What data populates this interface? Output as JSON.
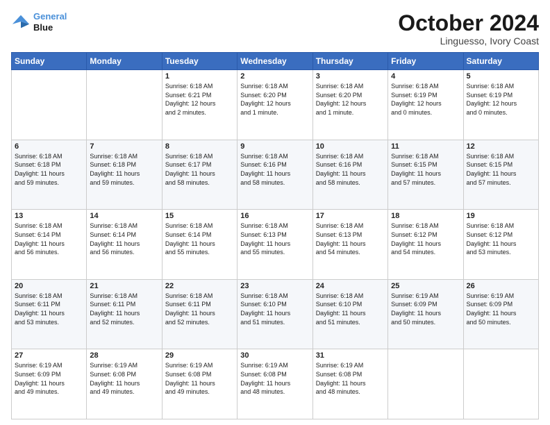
{
  "header": {
    "logo_line1": "General",
    "logo_line2": "Blue",
    "month": "October 2024",
    "location": "Linguesso, Ivory Coast"
  },
  "weekdays": [
    "Sunday",
    "Monday",
    "Tuesday",
    "Wednesday",
    "Thursday",
    "Friday",
    "Saturday"
  ],
  "weeks": [
    [
      {
        "day": "",
        "info": ""
      },
      {
        "day": "",
        "info": ""
      },
      {
        "day": "1",
        "info": "Sunrise: 6:18 AM\nSunset: 6:21 PM\nDaylight: 12 hours\nand 2 minutes."
      },
      {
        "day": "2",
        "info": "Sunrise: 6:18 AM\nSunset: 6:20 PM\nDaylight: 12 hours\nand 1 minute."
      },
      {
        "day": "3",
        "info": "Sunrise: 6:18 AM\nSunset: 6:20 PM\nDaylight: 12 hours\nand 1 minute."
      },
      {
        "day": "4",
        "info": "Sunrise: 6:18 AM\nSunset: 6:19 PM\nDaylight: 12 hours\nand 0 minutes."
      },
      {
        "day": "5",
        "info": "Sunrise: 6:18 AM\nSunset: 6:19 PM\nDaylight: 12 hours\nand 0 minutes."
      }
    ],
    [
      {
        "day": "6",
        "info": "Sunrise: 6:18 AM\nSunset: 6:18 PM\nDaylight: 11 hours\nand 59 minutes."
      },
      {
        "day": "7",
        "info": "Sunrise: 6:18 AM\nSunset: 6:18 PM\nDaylight: 11 hours\nand 59 minutes."
      },
      {
        "day": "8",
        "info": "Sunrise: 6:18 AM\nSunset: 6:17 PM\nDaylight: 11 hours\nand 58 minutes."
      },
      {
        "day": "9",
        "info": "Sunrise: 6:18 AM\nSunset: 6:16 PM\nDaylight: 11 hours\nand 58 minutes."
      },
      {
        "day": "10",
        "info": "Sunrise: 6:18 AM\nSunset: 6:16 PM\nDaylight: 11 hours\nand 58 minutes."
      },
      {
        "day": "11",
        "info": "Sunrise: 6:18 AM\nSunset: 6:15 PM\nDaylight: 11 hours\nand 57 minutes."
      },
      {
        "day": "12",
        "info": "Sunrise: 6:18 AM\nSunset: 6:15 PM\nDaylight: 11 hours\nand 57 minutes."
      }
    ],
    [
      {
        "day": "13",
        "info": "Sunrise: 6:18 AM\nSunset: 6:14 PM\nDaylight: 11 hours\nand 56 minutes."
      },
      {
        "day": "14",
        "info": "Sunrise: 6:18 AM\nSunset: 6:14 PM\nDaylight: 11 hours\nand 56 minutes."
      },
      {
        "day": "15",
        "info": "Sunrise: 6:18 AM\nSunset: 6:14 PM\nDaylight: 11 hours\nand 55 minutes."
      },
      {
        "day": "16",
        "info": "Sunrise: 6:18 AM\nSunset: 6:13 PM\nDaylight: 11 hours\nand 55 minutes."
      },
      {
        "day": "17",
        "info": "Sunrise: 6:18 AM\nSunset: 6:13 PM\nDaylight: 11 hours\nand 54 minutes."
      },
      {
        "day": "18",
        "info": "Sunrise: 6:18 AM\nSunset: 6:12 PM\nDaylight: 11 hours\nand 54 minutes."
      },
      {
        "day": "19",
        "info": "Sunrise: 6:18 AM\nSunset: 6:12 PM\nDaylight: 11 hours\nand 53 minutes."
      }
    ],
    [
      {
        "day": "20",
        "info": "Sunrise: 6:18 AM\nSunset: 6:11 PM\nDaylight: 11 hours\nand 53 minutes."
      },
      {
        "day": "21",
        "info": "Sunrise: 6:18 AM\nSunset: 6:11 PM\nDaylight: 11 hours\nand 52 minutes."
      },
      {
        "day": "22",
        "info": "Sunrise: 6:18 AM\nSunset: 6:11 PM\nDaylight: 11 hours\nand 52 minutes."
      },
      {
        "day": "23",
        "info": "Sunrise: 6:18 AM\nSunset: 6:10 PM\nDaylight: 11 hours\nand 51 minutes."
      },
      {
        "day": "24",
        "info": "Sunrise: 6:18 AM\nSunset: 6:10 PM\nDaylight: 11 hours\nand 51 minutes."
      },
      {
        "day": "25",
        "info": "Sunrise: 6:19 AM\nSunset: 6:09 PM\nDaylight: 11 hours\nand 50 minutes."
      },
      {
        "day": "26",
        "info": "Sunrise: 6:19 AM\nSunset: 6:09 PM\nDaylight: 11 hours\nand 50 minutes."
      }
    ],
    [
      {
        "day": "27",
        "info": "Sunrise: 6:19 AM\nSunset: 6:09 PM\nDaylight: 11 hours\nand 49 minutes."
      },
      {
        "day": "28",
        "info": "Sunrise: 6:19 AM\nSunset: 6:08 PM\nDaylight: 11 hours\nand 49 minutes."
      },
      {
        "day": "29",
        "info": "Sunrise: 6:19 AM\nSunset: 6:08 PM\nDaylight: 11 hours\nand 49 minutes."
      },
      {
        "day": "30",
        "info": "Sunrise: 6:19 AM\nSunset: 6:08 PM\nDaylight: 11 hours\nand 48 minutes."
      },
      {
        "day": "31",
        "info": "Sunrise: 6:19 AM\nSunset: 6:08 PM\nDaylight: 11 hours\nand 48 minutes."
      },
      {
        "day": "",
        "info": ""
      },
      {
        "day": "",
        "info": ""
      }
    ]
  ]
}
